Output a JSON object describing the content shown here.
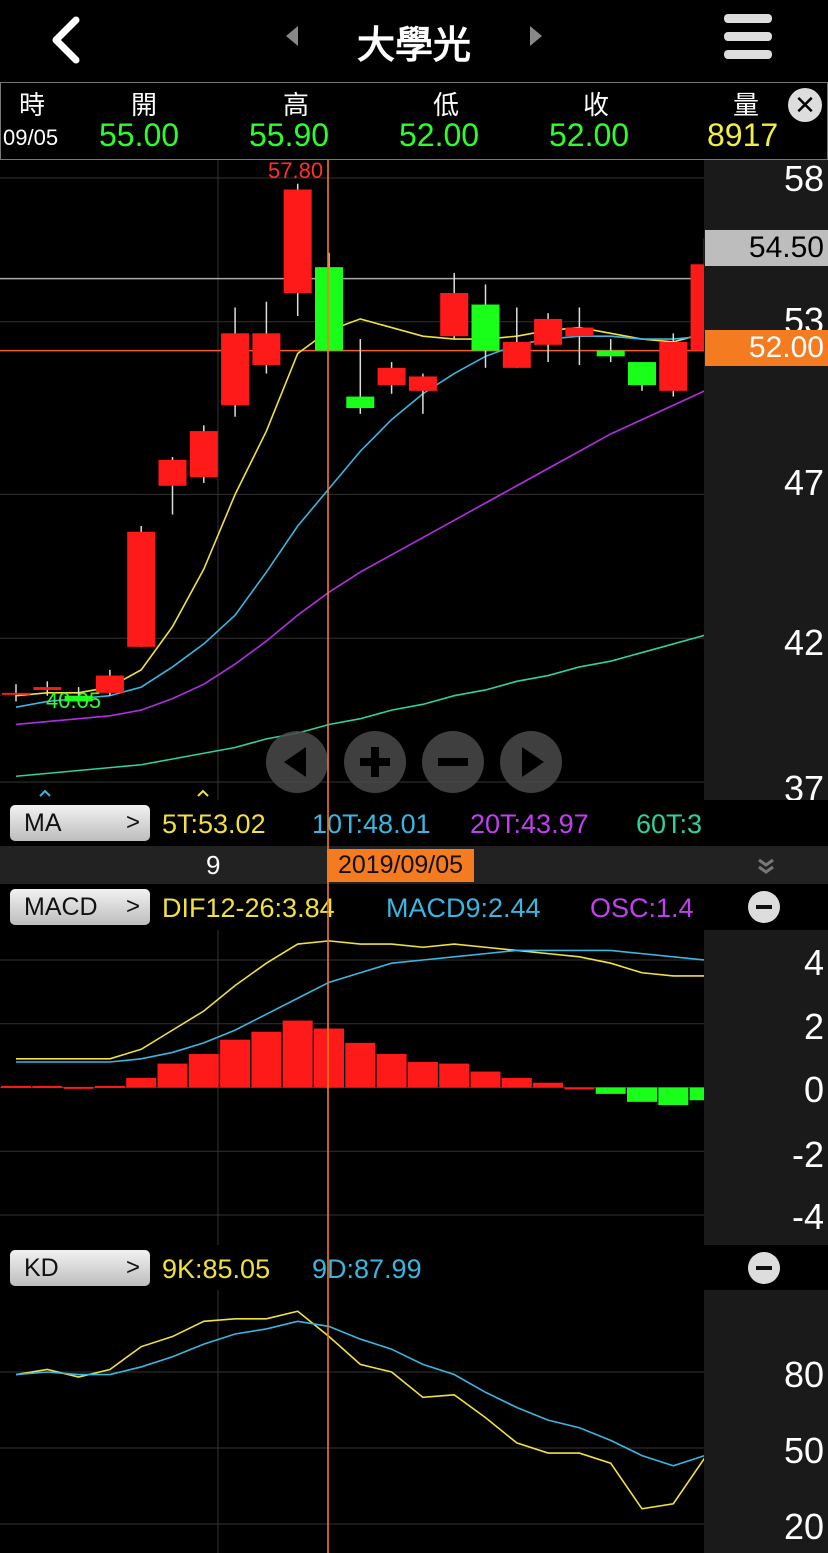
{
  "header": {
    "title": "大學光",
    "back_icon": "chevron-left-icon",
    "menu_icon": "hamburger-icon"
  },
  "quote": {
    "labels": [
      "時",
      "開",
      "高",
      "低",
      "收",
      "量"
    ],
    "time": "09/05",
    "open": "55.00",
    "high": "55.90",
    "low": "52.00",
    "close": "52.00",
    "volume": "8917",
    "close_icon": "close-icon"
  },
  "main_chart": {
    "y_ticks": [
      "58",
      "53",
      "47",
      "42",
      "37"
    ],
    "price_tag_ref": "54.50",
    "price_tag_close": "52.00",
    "high_label": "57.80",
    "low_label": "40.05",
    "colors": {
      "up": "#ff1a1a",
      "down": "#1aff1a",
      "ma5": "#f0e040",
      "ma10": "#3ab6e0",
      "ma20": "#b030e0",
      "ma60": "#30d0a0",
      "cursor": "#f47b20"
    }
  },
  "chart_data": [
    {
      "type": "candlestick",
      "title": "",
      "ylim": [
        37,
        58
      ],
      "candles": [
        {
          "o": 40.1,
          "h": 40.4,
          "l": 39.8,
          "c": 40.1
        },
        {
          "o": 40.2,
          "h": 40.5,
          "l": 40.0,
          "c": 40.3
        },
        {
          "o": 40.0,
          "h": 40.3,
          "l": 39.7,
          "c": 39.8
        },
        {
          "o": 40.1,
          "h": 40.9,
          "l": 40.0,
          "c": 40.7
        },
        {
          "o": 41.7,
          "h": 45.9,
          "l": 41.7,
          "c": 45.7
        },
        {
          "o": 47.3,
          "h": 48.3,
          "l": 46.3,
          "c": 48.2
        },
        {
          "o": 47.6,
          "h": 49.4,
          "l": 47.4,
          "c": 49.2
        },
        {
          "o": 50.1,
          "h": 53.5,
          "l": 49.7,
          "c": 52.6
        },
        {
          "o": 51.5,
          "h": 53.7,
          "l": 51.2,
          "c": 52.6
        },
        {
          "o": 54.0,
          "h": 57.8,
          "l": 53.2,
          "c": 57.6
        },
        {
          "o": 54.9,
          "h": 55.4,
          "l": 52.0,
          "c": 52.0
        },
        {
          "o": 50.4,
          "h": 52.4,
          "l": 49.8,
          "c": 50.0
        },
        {
          "o": 50.8,
          "h": 51.6,
          "l": 50.5,
          "c": 51.4
        },
        {
          "o": 50.6,
          "h": 51.2,
          "l": 49.8,
          "c": 51.1
        },
        {
          "o": 52.5,
          "h": 54.7,
          "l": 52.4,
          "c": 54.0
        },
        {
          "o": 53.6,
          "h": 54.3,
          "l": 51.4,
          "c": 52.0
        },
        {
          "o": 51.4,
          "h": 53.5,
          "l": 51.4,
          "c": 52.3
        },
        {
          "o": 52.2,
          "h": 53.3,
          "l": 51.6,
          "c": 53.1
        },
        {
          "o": 52.5,
          "h": 53.5,
          "l": 51.5,
          "c": 52.8
        },
        {
          "o": 52.0,
          "h": 52.4,
          "l": 51.6,
          "c": 51.8
        },
        {
          "o": 51.6,
          "h": 51.6,
          "l": 50.6,
          "c": 50.8
        },
        {
          "o": 50.6,
          "h": 52.6,
          "l": 50.4,
          "c": 52.3
        },
        {
          "o": 52.0,
          "h": 55.9,
          "l": 52.0,
          "c": 55.0
        }
      ],
      "series": [
        {
          "name": "5T",
          "values": [
            40.0,
            40.1,
            40.1,
            40.3,
            40.9,
            42.4,
            44.4,
            47.0,
            49.2,
            51.9,
            52.7,
            53.1,
            52.8,
            52.5,
            52.4,
            52.4,
            52.5,
            52.7,
            52.8,
            52.6,
            52.4,
            52.3,
            52.6
          ]
        },
        {
          "name": "10T",
          "values": [
            39.6,
            39.8,
            39.9,
            40.0,
            40.3,
            41.0,
            41.8,
            42.8,
            44.3,
            45.9,
            47.2,
            48.5,
            49.6,
            50.5,
            51.2,
            51.8,
            52.2,
            52.4,
            52.5,
            52.5,
            52.4,
            52.4,
            52.5
          ]
        },
        {
          "name": "20T",
          "values": [
            39.0,
            39.1,
            39.2,
            39.3,
            39.5,
            39.9,
            40.4,
            41.1,
            41.9,
            42.8,
            43.6,
            44.3,
            44.9,
            45.5,
            46.1,
            46.7,
            47.3,
            47.9,
            48.5,
            49.1,
            49.6,
            50.1,
            50.6
          ]
        },
        {
          "name": "60T",
          "values": [
            37.2,
            37.3,
            37.4,
            37.5,
            37.6,
            37.8,
            38.0,
            38.2,
            38.5,
            38.7,
            39.0,
            39.2,
            39.5,
            39.7,
            40.0,
            40.2,
            40.5,
            40.7,
            41.0,
            41.2,
            41.5,
            41.8,
            42.1
          ]
        }
      ]
    },
    {
      "type": "bar",
      "title": "",
      "ylim": [
        -4,
        4
      ],
      "values": [
        0.05,
        0.05,
        0.02,
        0.05,
        0.3,
        0.75,
        1.05,
        1.5,
        1.75,
        2.1,
        1.85,
        1.4,
        1.05,
        0.8,
        0.75,
        0.5,
        0.3,
        0.15,
        0.0,
        -0.2,
        -0.45,
        -0.55,
        -0.4
      ],
      "series": [
        {
          "name": "DIF12-26",
          "values": [
            0.9,
            0.9,
            0.9,
            0.9,
            1.2,
            1.8,
            2.4,
            3.2,
            3.9,
            4.5,
            4.6,
            4.5,
            4.5,
            4.4,
            4.5,
            4.4,
            4.3,
            4.2,
            4.1,
            3.9,
            3.6,
            3.5,
            3.5
          ]
        },
        {
          "name": "MACD9",
          "values": [
            0.8,
            0.8,
            0.8,
            0.8,
            0.9,
            1.1,
            1.4,
            1.8,
            2.3,
            2.8,
            3.3,
            3.6,
            3.9,
            4.0,
            4.1,
            4.2,
            4.3,
            4.3,
            4.3,
            4.3,
            4.2,
            4.1,
            4.0
          ]
        }
      ]
    },
    {
      "type": "line",
      "title": "",
      "ylim": [
        20,
        100
      ],
      "series": [
        {
          "name": "9K",
          "values": [
            79,
            81,
            78,
            81,
            90,
            94,
            100,
            101,
            101,
            104,
            94,
            83,
            80,
            70,
            71,
            62,
            52,
            48,
            48,
            44,
            26,
            28,
            46
          ]
        },
        {
          "name": "9D",
          "values": [
            79,
            80,
            79,
            79,
            82,
            86,
            91,
            95,
            97,
            100,
            98,
            93,
            89,
            83,
            79,
            72,
            66,
            61,
            58,
            53,
            47,
            43,
            47
          ]
        }
      ]
    }
  ],
  "ma_bar": {
    "button": "MA",
    "ma5": "5T:53.02",
    "ma10": "10T:48.01",
    "ma20": "20T:43.97",
    "ma60": "60T:3"
  },
  "date_bar": {
    "tick": "9",
    "cursor_date": "2019/09/05"
  },
  "macd_bar": {
    "button": "MACD",
    "dif": "DIF12-26:3.84",
    "macd": "MACD9:2.44",
    "osc": "OSC:1.4",
    "y_ticks": [
      "4",
      "2",
      "0",
      "-2",
      "-4"
    ]
  },
  "kd_bar": {
    "button": "KD",
    "k": "9K:85.05",
    "d": "9D:87.99",
    "y_ticks": [
      "80",
      "50",
      "20"
    ]
  }
}
